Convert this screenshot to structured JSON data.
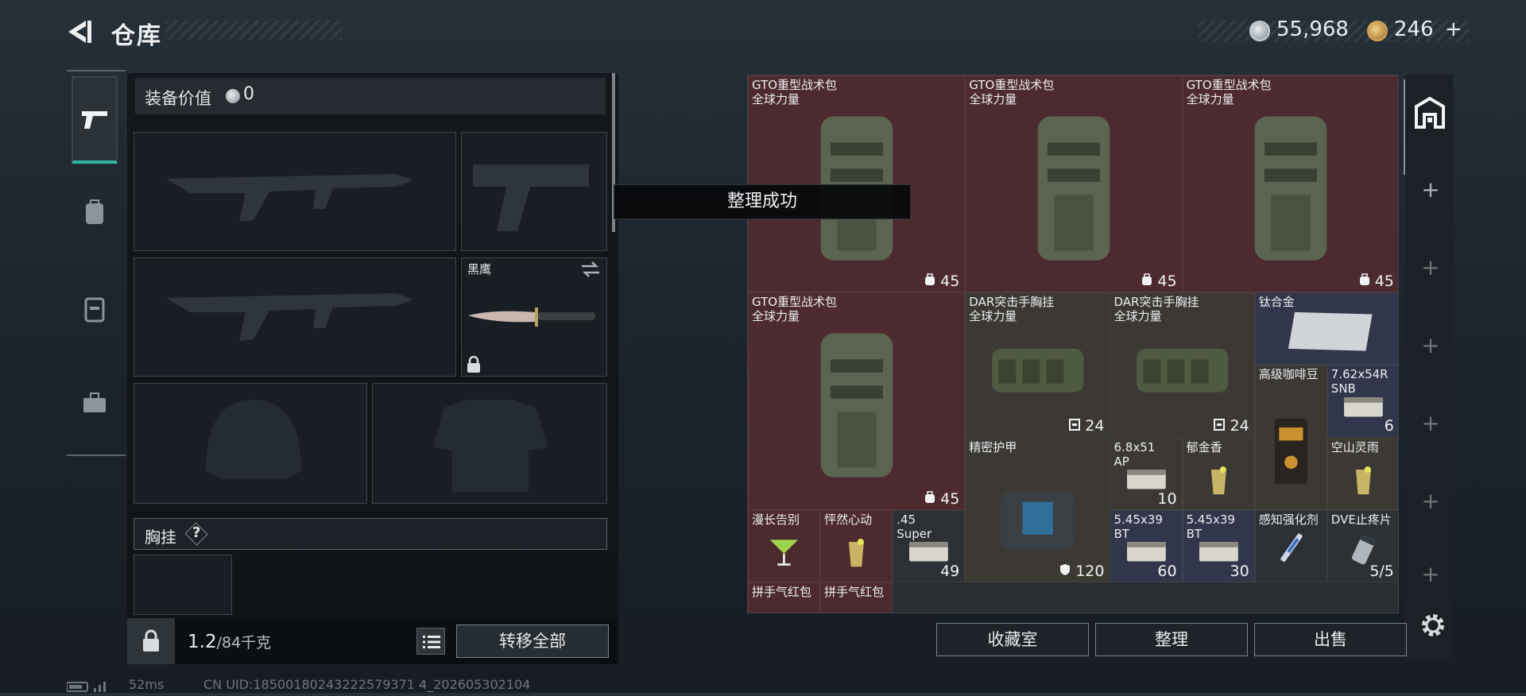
{
  "header": {
    "title": "仓库",
    "currency1": "55,968",
    "currency2": "246",
    "plus": "+"
  },
  "loadout": {
    "value_label": "装备价值",
    "value_num": "0",
    "knife_name": "黑鹰",
    "chest_label": "胸挂",
    "chest_help": "?",
    "weight_current": "1.2",
    "weight_max": "/84千克",
    "transfer_all": "转移全部"
  },
  "status": {
    "ping": "52ms",
    "uid": "CN UID:18500180243222579371 4_202605302104"
  },
  "toast": "整理成功",
  "stash": {
    "items": [
      {
        "name": "GTO重型战术包",
        "sub": "全球力量",
        "count": "45"
      },
      {
        "name": "GTO重型战术包",
        "sub": "全球力量",
        "count": "45"
      },
      {
        "name": "GTO重型战术包",
        "sub": "全球力量",
        "count": "45"
      },
      {
        "name": "GTO重型战术包",
        "sub": "全球力量",
        "count": "45"
      },
      {
        "name": "DAR突击手胸挂",
        "sub": "全球力量",
        "count": "24"
      },
      {
        "name": "DAR突击手胸挂",
        "sub": "全球力量",
        "count": "24"
      },
      {
        "name": "钛合金",
        "sub": "",
        "count": ""
      },
      {
        "name": "高级咖啡豆",
        "sub": "",
        "count": ""
      },
      {
        "name": "7.62x54R",
        "sub": "SNB",
        "count": "6"
      },
      {
        "name": "精密护甲",
        "sub": "",
        "count": "120"
      },
      {
        "name": "6.8x51",
        "sub": "AP",
        "count": "10"
      },
      {
        "name": "郁金香",
        "sub": "",
        "count": ""
      },
      {
        "name": "空山灵雨",
        "sub": "",
        "count": ""
      },
      {
        "name": "漫长告别",
        "sub": "",
        "count": ""
      },
      {
        "name": "怦然心动",
        "sub": "",
        "count": ""
      },
      {
        "name": ".45",
        "sub": "Super",
        "count": "49"
      },
      {
        "name": "5.45x39",
        "sub": "BT",
        "count": "60"
      },
      {
        "name": "5.45x39",
        "sub": "BT",
        "count": "30"
      },
      {
        "name": "感知强化剂",
        "sub": "",
        "count": ""
      },
      {
        "name": "DVE止疼片",
        "sub": "",
        "count": "5/5"
      },
      {
        "name": "拼手气红包",
        "sub": "",
        "count": ""
      },
      {
        "name": "拼手气红包",
        "sub": "",
        "count": ""
      }
    ],
    "actions": {
      "collection": "收藏室",
      "sort": "整理",
      "sell": "出售"
    }
  },
  "colors": {
    "accent": "#2fb7a3",
    "red_rarity": "#4d2a2f",
    "blue_rarity": "#31364a"
  }
}
